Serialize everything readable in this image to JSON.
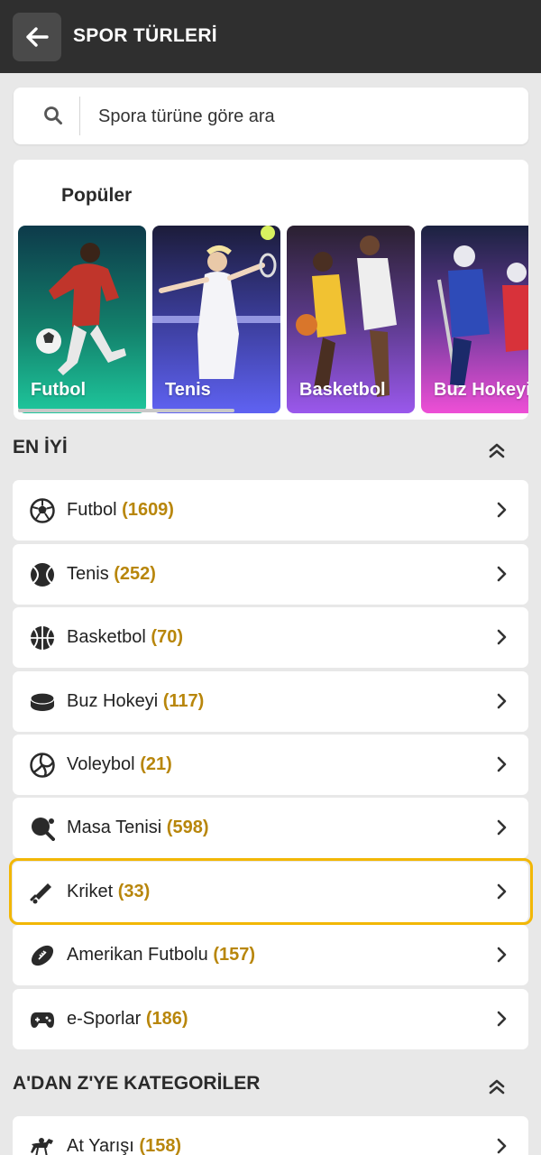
{
  "header": {
    "title": "SPOR TÜRLERİ",
    "back_icon": "arrow-left-icon"
  },
  "search": {
    "placeholder": "Spora türüne göre ara",
    "value": "",
    "icon": "search-icon"
  },
  "popular": {
    "title": "Popüler",
    "cards": [
      {
        "label": "Futbol",
        "color": "#16b38f"
      },
      {
        "label": "Tenis",
        "color": "#5a5cf0"
      },
      {
        "label": "Basketbol",
        "color": "#8b4fe0"
      },
      {
        "label": "Buz Hokeyi",
        "color": "#e44fd0"
      }
    ]
  },
  "best": {
    "title": "EN İYİ",
    "items": [
      {
        "name": "Futbol",
        "count": "(1609)",
        "icon": "soccer-ball-icon"
      },
      {
        "name": "Tenis",
        "count": "(252)",
        "icon": "tennis-ball-icon"
      },
      {
        "name": "Basketbol",
        "count": "(70)",
        "icon": "basketball-icon"
      },
      {
        "name": "Buz Hokeyi",
        "count": "(117)",
        "icon": "hockey-puck-icon"
      },
      {
        "name": "Voleybol",
        "count": "(21)",
        "icon": "volleyball-icon"
      },
      {
        "name": "Masa Tenisi",
        "count": "(598)",
        "icon": "ping-pong-icon"
      },
      {
        "name": "Kriket",
        "count": "(33)",
        "icon": "cricket-bat-icon"
      },
      {
        "name": "Amerikan Futbolu",
        "count": "(157)",
        "icon": "american-football-icon"
      },
      {
        "name": "e-Sporlar",
        "count": "(186)",
        "icon": "gamepad-icon"
      }
    ]
  },
  "az": {
    "title": "A'DAN Z'YE KATEGORİLER",
    "items": [
      {
        "name": "At Yarışı",
        "count": "(158)",
        "icon": "horse-icon"
      }
    ]
  },
  "colors": {
    "count": "#b8860b",
    "highlight": "#f2b705",
    "topbar": "#2f2f2f"
  }
}
